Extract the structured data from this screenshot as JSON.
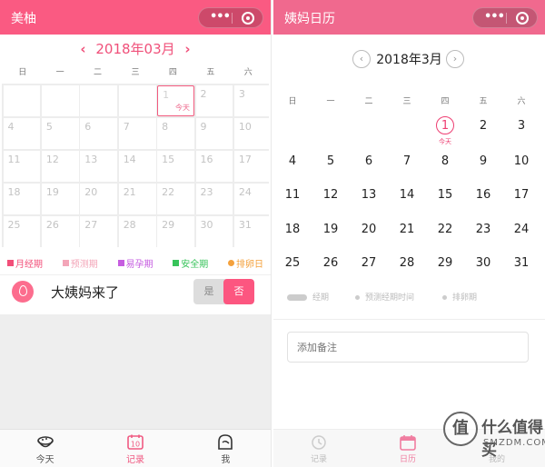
{
  "left": {
    "title": "美柚",
    "month_label": "2018年03月",
    "prev_arrow": "‹",
    "next_arrow": "›",
    "weekdays": [
      "日",
      "一",
      "二",
      "三",
      "四",
      "五",
      "六"
    ],
    "first_weekday": 4,
    "days_in_month": 31,
    "today": 1,
    "today_tag": "今天",
    "legend": [
      {
        "label": "月经期",
        "color": "#f24f79",
        "shape": "square"
      },
      {
        "label": "预测期",
        "color": "#f3a5b8",
        "shape": "square"
      },
      {
        "label": "易孕期",
        "color": "#c65de0",
        "shape": "square"
      },
      {
        "label": "安全期",
        "color": "#37c35a",
        "shape": "square"
      },
      {
        "label": "排卵日",
        "color": "#f4a13c",
        "shape": "dot"
      }
    ],
    "period_question": "大姨妈来了",
    "toggle_yes": "是",
    "toggle_no": "否",
    "tabs": [
      {
        "label": "今天",
        "icon": "bowl-icon"
      },
      {
        "label": "记录",
        "icon": "calendar-10-icon"
      },
      {
        "label": "我",
        "icon": "person-icon"
      }
    ],
    "calendar_icon_text": "10",
    "active_tab": 1
  },
  "right": {
    "title": "姨妈日历",
    "month_label": "2018年3月",
    "prev_arrow": "‹",
    "next_arrow": "›",
    "weekdays": [
      "日",
      "一",
      "二",
      "三",
      "四",
      "五",
      "六"
    ],
    "first_weekday": 4,
    "days_in_month": 31,
    "today": 1,
    "today_tag": "今天",
    "legend": [
      {
        "label": "经期",
        "shape": "bar"
      },
      {
        "label": "预测经期时间",
        "shape": "dot"
      },
      {
        "label": "排卵期",
        "shape": "dot"
      }
    ],
    "note_placeholder": "添加备注",
    "tabs": [
      {
        "label": "记录",
        "icon": "clock-icon"
      },
      {
        "label": "日历",
        "icon": "calendar-icon"
      },
      {
        "label": "我的",
        "icon": "person-icon"
      }
    ],
    "active_tab": 1
  },
  "watermark": {
    "logo_char": "值",
    "main": "什么值得买",
    "sub": "SMZDM.COM"
  },
  "colors": {
    "left_topbar": "#fa5a82",
    "right_topbar": "#f0698e",
    "accent": "#f25a7e"
  }
}
